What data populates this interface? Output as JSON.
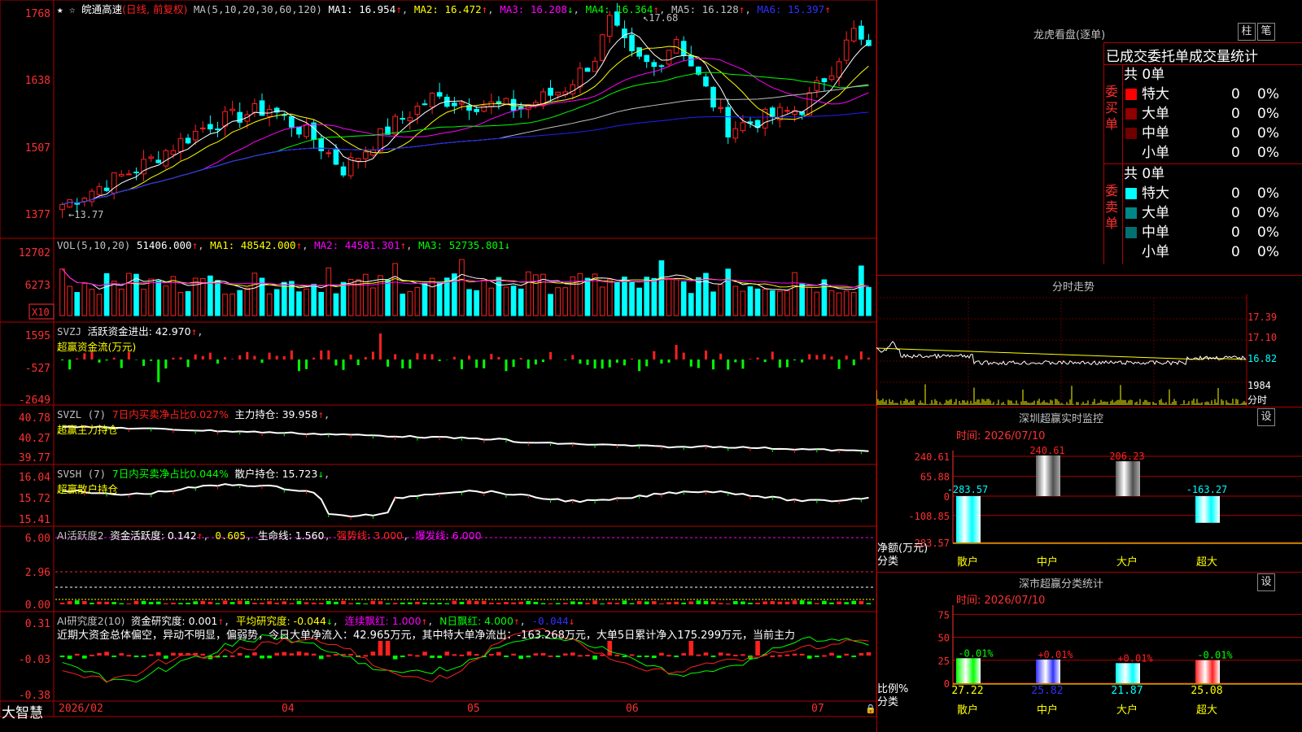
{
  "colors": {
    "up": "#ff2020",
    "down": "#00ffff",
    "ma1": "#ffffff",
    "ma2": "#ffff00",
    "ma3": "#ff00ff",
    "ma4": "#00ff00",
    "ma5": "#c0c0c0",
    "ma6": "#2020ff",
    "grid": "#b00000",
    "axis": "#ff3030"
  },
  "main": {
    "stock": "皖通高速",
    "period": "(日线, 前复权)",
    "ma_def": "MA(5,10,20,30,60,120)",
    "ma1": "MA1: 16.954",
    "ma2": "MA2: 16.472",
    "ma3": "MA3: 16.208",
    "ma4": "MA4: 16.364",
    "ma5": "MA5: 16.128",
    "ma6": "MA6: 15.397",
    "yticks": [
      "1768",
      "1638",
      "1507",
      "1377"
    ],
    "high_label": "17.68",
    "low_label": "13.77"
  },
  "vol": {
    "def": "VOL(5,10,20)",
    "v": "51406.000",
    "ma1": "MA1: 48542.000",
    "ma2": "MA2: 44581.301",
    "ma3": "MA3: 52735.801",
    "yticks": [
      "12702",
      "6273"
    ],
    "unit": "X10"
  },
  "svzj": {
    "def": "SVZJ",
    "label": "活跃资金进出: 42.970",
    "sub": "超赢资金流(万元)",
    "yticks": [
      "1595",
      "-527",
      "-2649"
    ]
  },
  "svzl": {
    "def": "SVZL (7)",
    "a": "7日内买卖净占比0.027%",
    "b": "主力持仓: 39.958",
    "sub": "超赢主力持仓",
    "yticks": [
      "40.78",
      "40.27",
      "39.77"
    ]
  },
  "svsh": {
    "def": "SVSH (7)",
    "a": "7日内买卖净占比0.044%",
    "b": "散户持仓: 15.723",
    "sub": "超赢散户持仓",
    "yticks": [
      "16.04",
      "15.72",
      "15.41"
    ]
  },
  "ai1": {
    "def": "AI活跃度2",
    "a": "资金活跃度: 0.142",
    "b": "0.605",
    "c": "生命线: 1.560",
    "d": "强势线: 3.000",
    "e": "爆发线: 6.000",
    "yticks": [
      "6.00",
      "2.96",
      "0.00"
    ]
  },
  "ai2": {
    "def": "AI研究度2(10)",
    "a": "资金研究度: 0.001",
    "b": "平均研究度: -0.044",
    "c": "连续飘红: 1.000",
    "d": "N日飘红: 4.000",
    "e": "-0.044",
    "comment": "近期大资金总体偏空，异动不明显，偏弱势，今日大单净流入：42.965万元，其中特大单净流出：-163.268万元，大单5日累计净入175.299万元，当前主力",
    "yticks": [
      "0.31",
      "-0.03",
      "-0.38"
    ]
  },
  "xaxis": {
    "brand": "大智慧",
    "labels": [
      "2026/02",
      "04",
      "05",
      "06",
      "07"
    ]
  },
  "lhb": {
    "title": "龙虎看盘(逐单)",
    "btn1": "柱",
    "btn2": "笔",
    "subtitle": "已成交委托单成交量统计",
    "buy_label": "委买单",
    "sell_label": "委卖单",
    "buy_total": "共 0单",
    "sell_total": "共 0单",
    "buy_rows": [
      {
        "name": "特大",
        "v": "0",
        "p": "0%",
        "c": "#ff0000"
      },
      {
        "name": "大单",
        "v": "0",
        "p": "0%",
        "c": "#900000"
      },
      {
        "name": "中单",
        "v": "0",
        "p": "0%",
        "c": "#700000"
      },
      {
        "name": "小单",
        "v": "0",
        "p": "0%",
        "c": ""
      }
    ],
    "sell_rows": [
      {
        "name": "特大",
        "v": "0",
        "p": "0%",
        "c": "#00ffff"
      },
      {
        "name": "大单",
        "v": "0",
        "p": "0%",
        "c": "#008888"
      },
      {
        "name": "中单",
        "v": "0",
        "p": "0%",
        "c": "#007070"
      },
      {
        "name": "小单",
        "v": "0",
        "p": "0%",
        "c": ""
      }
    ]
  },
  "fenshi": {
    "title": "分时走势",
    "yticks": [
      "17.39",
      "17.10",
      "16.82"
    ],
    "vol": "1984",
    "vol_unit": "分时"
  },
  "sz": {
    "title": "深圳超赢实时监控",
    "btn": "设",
    "time": "时间: 2026/07/10",
    "yticks": [
      "240.61",
      "65.88",
      "0",
      "-108.85",
      "-283.57"
    ],
    "bars": [
      {
        "cat": "散户",
        "label": "-283.57",
        "value": -283.57
      },
      {
        "cat": "中户",
        "label": "240.61",
        "value": 240.61
      },
      {
        "cat": "大户",
        "label": "206.23",
        "value": 206.23
      },
      {
        "cat": "超大",
        "label": "-163.27",
        "value": -163.27
      }
    ],
    "foot1": "净额(万元)",
    "foot2": "分类"
  },
  "ss": {
    "title": "深市超赢分类统计",
    "btn": "设",
    "time": "时间: 2026/07/10",
    "yticks": [
      "75",
      "50",
      "25",
      "0"
    ],
    "bars": [
      {
        "cat": "散户",
        "label": "-0.01%",
        "value": 27.22,
        "vlabel": "27.22",
        "c": "#00ff00"
      },
      {
        "cat": "中户",
        "label": "+0.01%",
        "value": 25.82,
        "vlabel": "25.82",
        "c": "#3030ff"
      },
      {
        "cat": "大户",
        "label": "+0.01%",
        "value": 21.87,
        "vlabel": "21.87",
        "c": "#00ffff"
      },
      {
        "cat": "超大",
        "label": "-0.01%",
        "value": 25.08,
        "vlabel": "25.08",
        "c": "#ff2020"
      }
    ],
    "foot1": "比例%",
    "foot2": "分类"
  }
}
